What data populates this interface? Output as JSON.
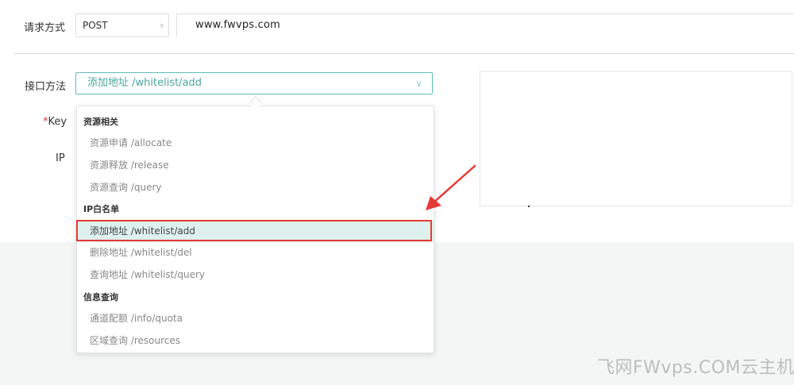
{
  "request": {
    "method_label": "请求方式",
    "method_value": "POST",
    "url": "www.fwvps.com"
  },
  "form": {
    "api_label": "接口方法",
    "api_selected": "添加地址 /whitelist/add",
    "key_required_mark": "*",
    "key_label": "Key",
    "ip_label": "IP"
  },
  "dropdown": {
    "groups": [
      {
        "title": "资源相关",
        "options": [
          "资源申请 /allocate",
          "资源释放 /release",
          "资源查询 /query"
        ]
      },
      {
        "title": "IP白名单",
        "options": [
          "添加地址 /whitelist/add",
          "删除地址 /whitelist/del",
          "查询地址 /whitelist/query"
        ]
      },
      {
        "title": "信息查询",
        "options": [
          "通道配额 /info/quota",
          "区域查询 /resources"
        ]
      }
    ],
    "active_option": "添加地址 /whitelist/add"
  },
  "watermark": "飞网FWvps.COM云主机",
  "colors": {
    "accent": "#4aa89f",
    "active_bg": "#dff1ef",
    "annotation_red": "#e53935"
  },
  "icons": {
    "method_chevron": "chevron-right-icon",
    "api_chevron": "chevron-down-icon",
    "annotation": "arrow-annotation-icon"
  }
}
